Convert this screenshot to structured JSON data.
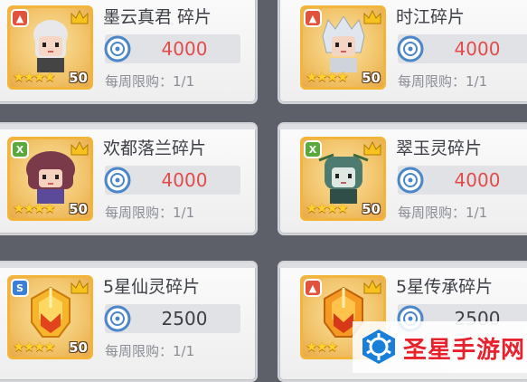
{
  "cards": [
    {
      "name": "墨云真君 碎片",
      "price": "4000",
      "price_color": "red",
      "limit": "每周限购：1/1",
      "stars": "★★★★",
      "level": "50",
      "badge": "red",
      "badge_glyph": "▲",
      "hair": "#e8e8ea",
      "skin": "#f6d6c4",
      "robe": "#444"
    },
    {
      "name": "时江碎片",
      "price": "4000",
      "price_color": "red",
      "limit": "每周限购：1/1",
      "stars": "★★★★",
      "level": "50",
      "badge": "red",
      "badge_glyph": "▲",
      "hair": "#dfe6ee",
      "skin": "#f4d5c4",
      "robe": "#cfd4da"
    },
    {
      "name": "欢都落兰碎片",
      "price": "4000",
      "price_color": "red",
      "limit": "每周限购：1/1",
      "stars": "★★★★",
      "level": "50",
      "badge": "green",
      "badge_glyph": "X",
      "hair": "#7a3a4a",
      "skin": "#f5d2c0",
      "robe": "#5b4a9a"
    },
    {
      "name": "翠玉灵碎片",
      "price": "4000",
      "price_color": "red",
      "limit": "每周限购：1/1",
      "stars": "★★★★",
      "level": "50",
      "badge": "green",
      "badge_glyph": "X",
      "hair": "#4e7b70",
      "skin": "#dfe8e2",
      "robe": "#2f4e48"
    },
    {
      "name": "5星仙灵碎片",
      "price": "2500",
      "price_color": "dark",
      "limit": "每周限购：1/1",
      "stars": "★★★★",
      "level": "50",
      "badge": "blue",
      "badge_glyph": "S",
      "helmet": true
    },
    {
      "name": "5星传承碎片",
      "price": "2500",
      "price_color": "dark",
      "limit": "",
      "stars": "★★★",
      "level": "",
      "badge": "red",
      "badge_glyph": "▲",
      "helmet": true
    }
  ],
  "watermark": {
    "text": "圣星手游网",
    "color": "#e8222c"
  }
}
